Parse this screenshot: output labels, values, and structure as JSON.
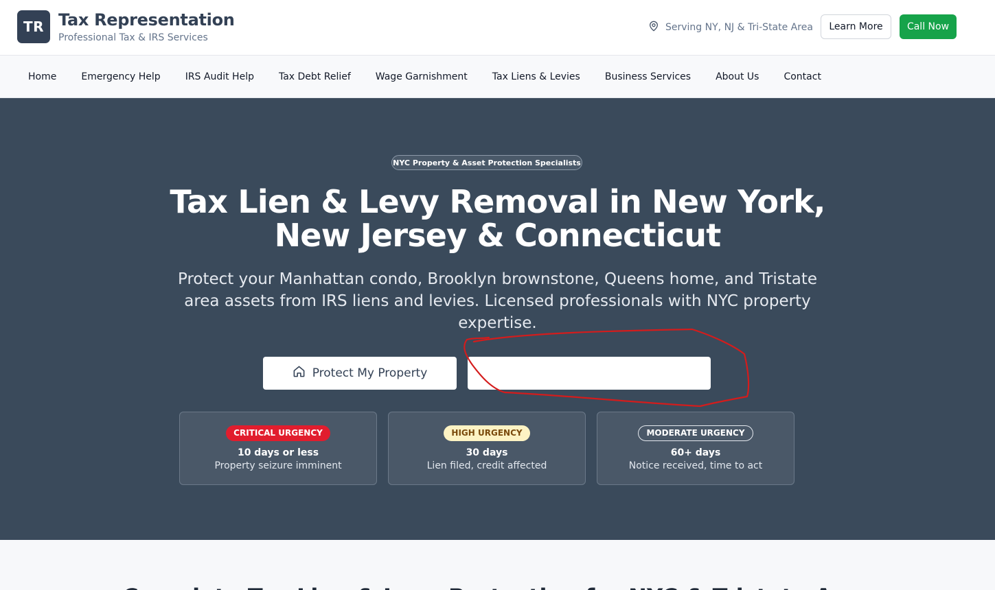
{
  "header": {
    "logo_initials": "TR",
    "title": "Tax Representation",
    "subtitle": "Professional Tax & IRS Services",
    "serving_text": "Serving NY, NJ & Tri-State Area",
    "learn_more_label": "Learn More",
    "call_now_label": "Call Now"
  },
  "nav": {
    "items": [
      {
        "label": "Home"
      },
      {
        "label": "Emergency Help"
      },
      {
        "label": "IRS Audit Help"
      },
      {
        "label": "Tax Debt Relief"
      },
      {
        "label": "Wage Garnishment"
      },
      {
        "label": "Tax Liens & Levies"
      },
      {
        "label": "Business Services"
      },
      {
        "label": "About Us"
      },
      {
        "label": "Contact"
      }
    ]
  },
  "hero": {
    "pill": "NYC Property & Asset Protection Specialists",
    "title_line1": "Tax Lien & Levy Removal in New York,",
    "title_line2": "New Jersey & Connecticut",
    "description": "Protect your Manhattan condo, Brooklyn brownstone, Queens home, and Tristate area assets from IRS liens and levies. Licensed professionals with NYC property expertise.",
    "primary_button": "Protect My Property",
    "secondary_button": ""
  },
  "urgency_cards": [
    {
      "badge": "CRITICAL URGENCY",
      "days": "10 days or less",
      "note": "Property seizure imminent"
    },
    {
      "badge": "HIGH URGENCY",
      "days": "30 days",
      "note": "Lien filed, credit affected"
    },
    {
      "badge": "MODERATE URGENCY",
      "days": "60+ days",
      "note": "Notice received, time to act"
    }
  ],
  "next_section": {
    "heading": "Complete Tax Lien & Levy Protection for NYC & Tristate Area"
  },
  "colors": {
    "brand_dark": "#334155",
    "hero_bg": "#3a4a5b",
    "call_green": "#16a34a",
    "critical_red": "#e11d2e",
    "annotation_red": "#d41c1c"
  }
}
